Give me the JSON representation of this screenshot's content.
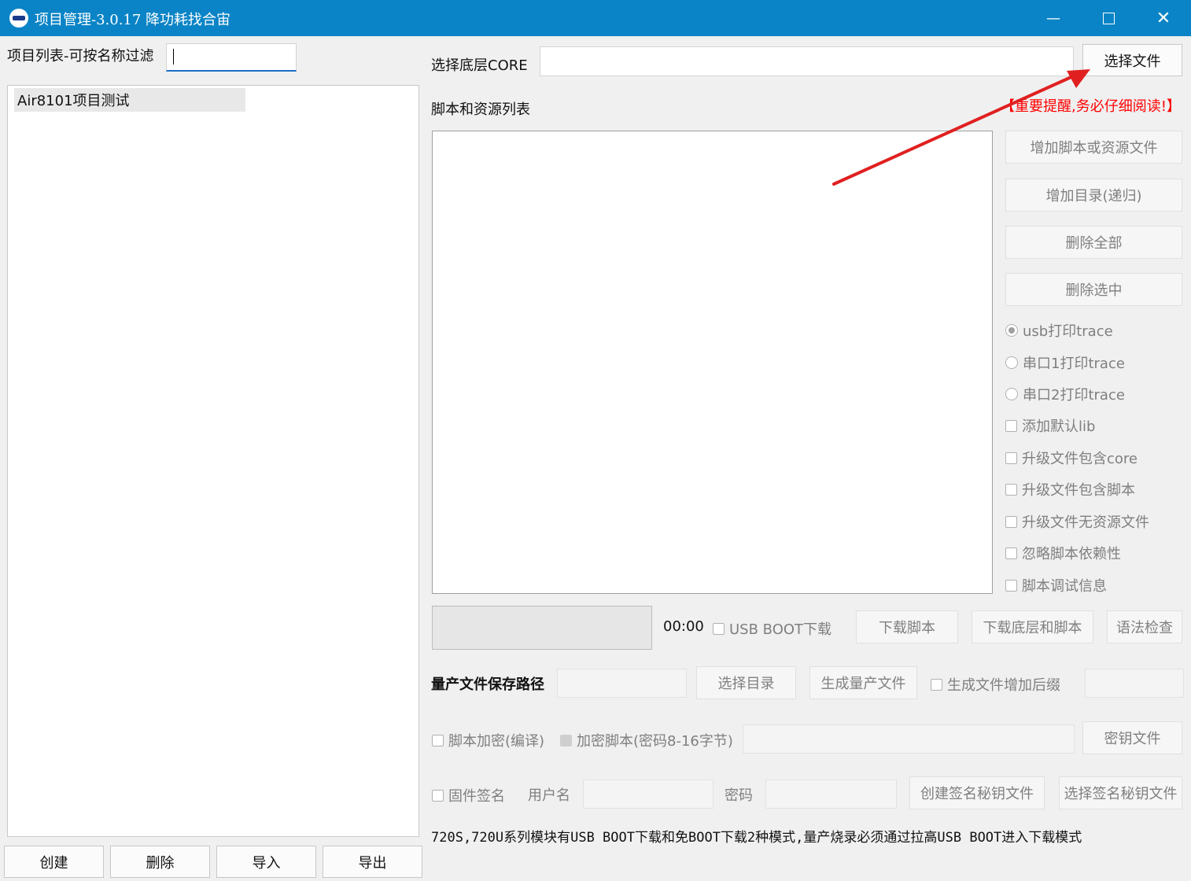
{
  "window": {
    "title": "项目管理-3.0.17 降功耗找合宙",
    "minimize_glyph": "—",
    "maximize_glyph": "☐",
    "close_glyph": "✕"
  },
  "left": {
    "filter_label": "项目列表-可按名称过滤",
    "filter_value": "",
    "projects": [
      "Air8101项目测试"
    ],
    "buttons": {
      "create": "创建",
      "delete": "删除",
      "import": "导入",
      "export": "导出"
    }
  },
  "core": {
    "label": "选择底层CORE",
    "value": "",
    "select_file": "选择文件"
  },
  "scripts": {
    "label": "脚本和资源列表",
    "warning": "【重要提醒,务必仔细阅读!】",
    "warning_color": "#ff0000",
    "add_script": "增加脚本或资源文件",
    "add_dir": "增加目录(递归)",
    "delete_all": "删除全部",
    "delete_selected": "删除选中"
  },
  "options": {
    "radios": [
      {
        "label": "usb打印trace",
        "checked": true
      },
      {
        "label": "串口1打印trace",
        "checked": false
      },
      {
        "label": "串口2打印trace",
        "checked": false
      }
    ],
    "checks": [
      "添加默认lib",
      "升级文件包含core",
      "升级文件包含脚本",
      "升级文件无资源文件",
      "忽略脚本依赖性",
      "脚本调试信息"
    ]
  },
  "download": {
    "timer": "00:00",
    "usb_boot": "USB BOOT下载",
    "download_script": "下载脚本",
    "download_core_script": "下载底层和脚本",
    "syntax_check": "语法检查"
  },
  "mass": {
    "path_label": "量产文件保存路径",
    "select_dir": "选择目录",
    "generate": "生成量产文件",
    "suffix_check": "生成文件增加后缀"
  },
  "encrypt": {
    "compile_check": "脚本加密(编译)",
    "encrypt_check": "加密脚本(密码8-16字节)",
    "key_file": "密钥文件"
  },
  "sign": {
    "firmware_sign": "固件签名",
    "username": "用户名",
    "password": "密码",
    "create_key": "创建签名秘钥文件",
    "select_key": "选择签名秘钥文件"
  },
  "note": "720S,720U系列模块有USB BOOT下载和免BOOT下载2种模式,量产烧录必须通过拉高USB BOOT进入下载模式",
  "colors": {
    "titlebar": "#0a84c6",
    "arrow": "#e02020"
  }
}
